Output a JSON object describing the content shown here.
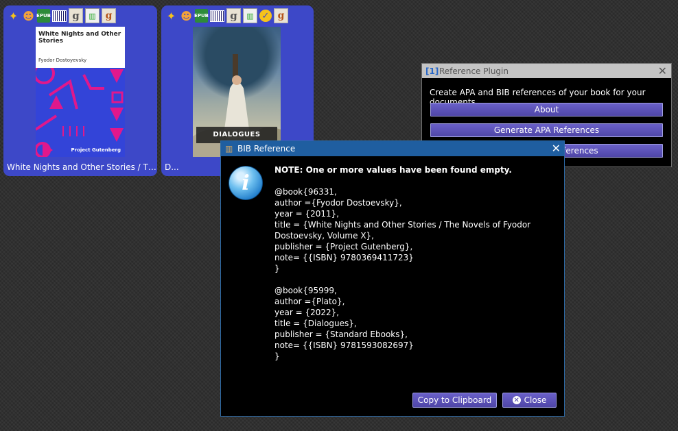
{
  "books": [
    {
      "title": "White Nights and Other Stories / The N...",
      "cover": {
        "title": "White Nights and Other Stories",
        "author": "Fyodor Dostoyevsky",
        "publisher": "Project Gutenberg"
      },
      "icons": [
        "wand-icon",
        "author-icon",
        "epub-icon",
        "barcode-icon",
        "goodreads-icon",
        "stats-icon",
        "goodreads-badge-icon"
      ],
      "epub_label": "EPUB",
      "goodreads_glyph": "g"
    },
    {
      "title": "D...",
      "cover": {
        "label": "DIALOGUES"
      },
      "icons": [
        "wand-icon",
        "author-icon",
        "epub-icon",
        "barcode-icon",
        "goodreads-icon",
        "stats-icon",
        "check-icon",
        "goodreads-badge-icon"
      ],
      "epub_label": "EPUB",
      "goodreads_glyph": "g"
    }
  ],
  "plugin": {
    "title": "Reference Plugin",
    "icon_glyph": "[1]",
    "description": "Create APA and BIB references of your book for your documents.",
    "buttons": [
      "About",
      "Generate APA References",
      "Generate BIB References"
    ]
  },
  "bib_dialog": {
    "title": "BIB Reference",
    "note": "NOTE: One or more values have been found empty.",
    "text": "@book{96331,\nauthor ={Fyodor Dostoevsky},\nyear = {2011},\ntitle = {White Nights and Other Stories / The Novels of Fyodor Dostoevsky, Volume X},\npublisher = {Project Gutenberg},\nnote= {{ISBN} 9780369411723}\n}\n\n@book{95999,\nauthor ={Plato},\nyear = {2022},\ntitle = {Dialogues},\npublisher = {Standard Ebooks},\nnote= {{ISBN} 9781593082697}\n}",
    "copy_label": "Copy to Clipboard",
    "close_label": "Close"
  },
  "colors": {
    "card_bg": "#3d48c8",
    "dialog_bar": "#1f5ea0",
    "button": "#5a50b8"
  }
}
